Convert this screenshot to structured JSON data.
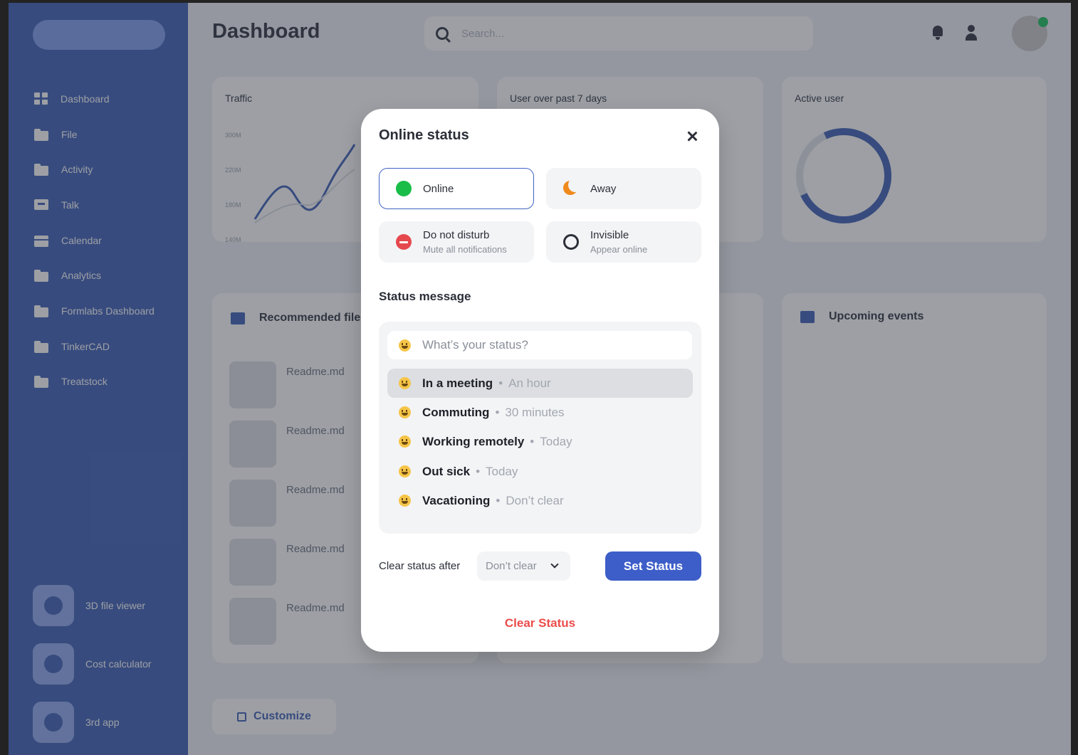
{
  "sidebar": {
    "items": [
      {
        "label": "Dashboard",
        "icon": "dashboard-grid-icon"
      },
      {
        "label": "File",
        "icon": "folder-icon"
      },
      {
        "label": "Activity",
        "icon": "folder-icon"
      },
      {
        "label": "Talk",
        "icon": "chat-icon"
      },
      {
        "label": "Calendar",
        "icon": "calendar-icon"
      },
      {
        "label": "Analytics",
        "icon": "folder-icon"
      },
      {
        "label": "Formlabs Dashboard",
        "icon": "folder-icon"
      },
      {
        "label": "TinkerCAD",
        "icon": "folder-icon"
      },
      {
        "label": "Treatstock",
        "icon": "folder-icon"
      }
    ],
    "apps": [
      {
        "label": "3D file viewer"
      },
      {
        "label": "Cost calculator"
      },
      {
        "label": "3rd app"
      }
    ]
  },
  "header": {
    "title": "Dashboard",
    "search_placeholder": "Search..."
  },
  "cards": {
    "traffic_title": "Traffic",
    "traffic_ticks": [
      "300M",
      "220M",
      "180M",
      "140M"
    ],
    "users_title": "User over past 7 days",
    "active_title": "Active user",
    "recommended_title": "Recommended files",
    "files": [
      "Readme.md",
      "Readme.md",
      "Readme.md",
      "Readme.md",
      "Readme.md"
    ],
    "events_title": "Upcoming events",
    "customize_label": "Customize"
  },
  "modal": {
    "title": "Online status",
    "options": [
      {
        "label": "Online",
        "sub": "",
        "selected": true
      },
      {
        "label": "Away",
        "sub": "",
        "selected": false
      },
      {
        "label": "Do not disturb",
        "sub": "Mute all notifications",
        "selected": false
      },
      {
        "label": "Invisible",
        "sub": "Appear online",
        "selected": false
      }
    ],
    "status_message_heading": "Status message",
    "status_input_placeholder": "What’s your status?",
    "presets": [
      {
        "label": "In a meeting",
        "duration": "An hour"
      },
      {
        "label": "Commuting",
        "duration": "30 minutes"
      },
      {
        "label": "Working remotely",
        "duration": "Today"
      },
      {
        "label": "Out sick",
        "duration": "Today"
      },
      {
        "label": "Vacationing",
        "duration": "Don’t clear"
      }
    ],
    "separator": "•",
    "clear_after_label": "Clear status after",
    "clear_after_value": "Don’t clear",
    "set_status_label": "Set Status",
    "clear_status_label": "Clear Status"
  },
  "colors": {
    "accent": "#3d5ec8",
    "online": "#19bd48",
    "away": "#f08a1c",
    "dnd": "#e5484d",
    "clear": "#ec4c4c"
  }
}
